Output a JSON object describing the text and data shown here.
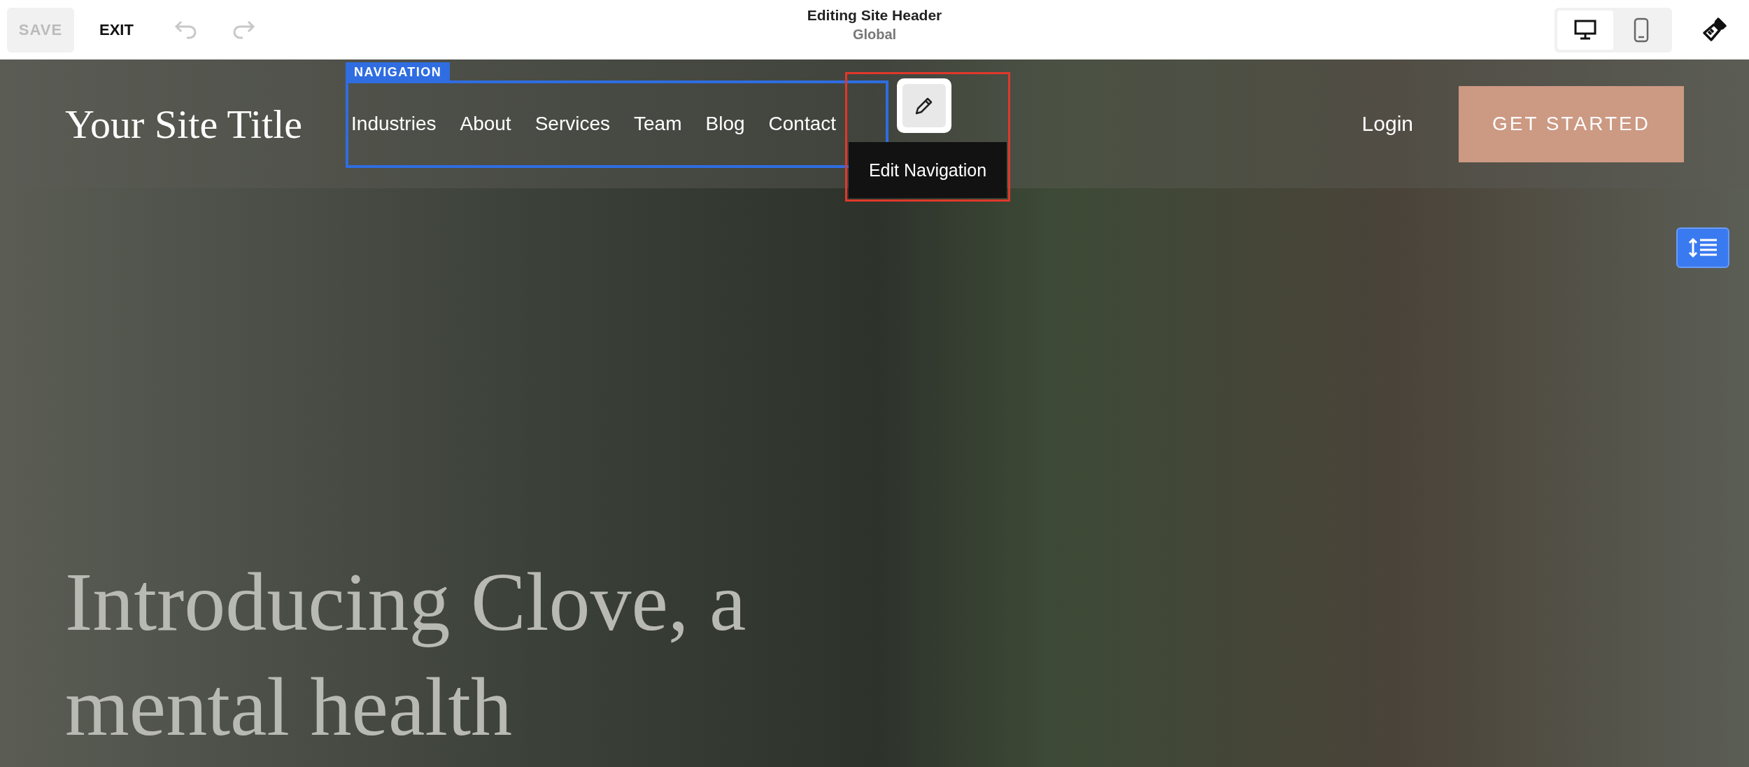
{
  "toolbar": {
    "save": {
      "label": "SAVE",
      "disabled": true
    },
    "exit": "EXIT",
    "undo": {
      "disabled": true
    },
    "redo": {
      "disabled": true
    },
    "title": "Editing Site Header",
    "subtitle": "Global",
    "devices": [
      {
        "kind": "desktop",
        "selected": true
      },
      {
        "kind": "mobile",
        "selected": false
      }
    ]
  },
  "header": {
    "site_title": "Your Site Title",
    "nav_badge": "NAVIGATION",
    "nav": [
      {
        "label": "Industries"
      },
      {
        "label": "About"
      },
      {
        "label": "Services"
      },
      {
        "label": "Team"
      },
      {
        "label": "Blog"
      },
      {
        "label": "Contact"
      }
    ],
    "edit_tooltip": "Edit Navigation",
    "login": "Login",
    "cta": "GET STARTED"
  },
  "hero": {
    "headline_lines": [
      "Introducing Clove, a",
      "mental health"
    ]
  }
}
